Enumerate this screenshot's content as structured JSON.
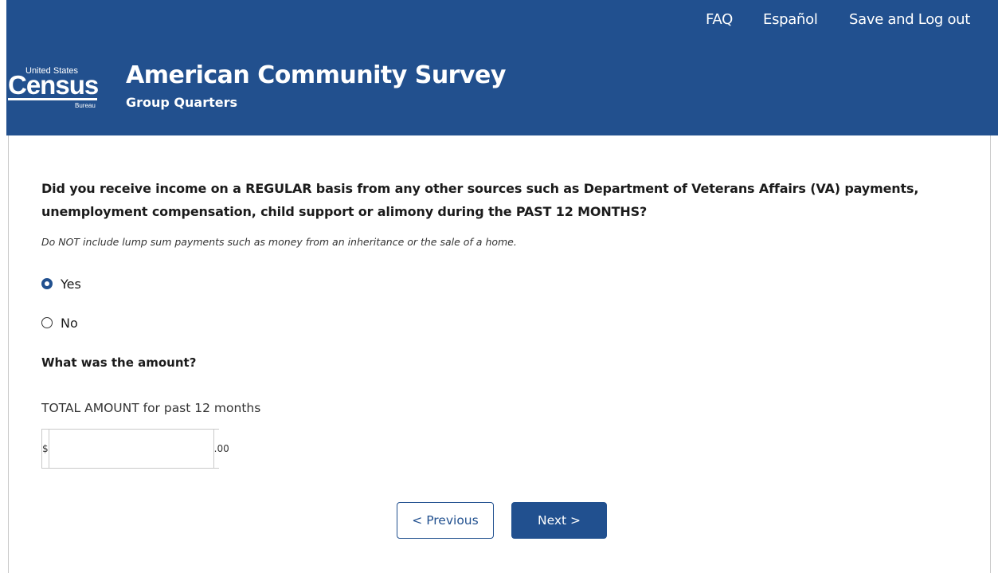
{
  "topnav": {
    "faq": "FAQ",
    "espanol": "Español",
    "save_logout": "Save and Log out"
  },
  "header": {
    "logo": {
      "united_states": "United States",
      "census": "Census",
      "bureau": "Bureau"
    },
    "title": "American Community Survey",
    "subtitle": "Group Quarters"
  },
  "question": {
    "text": "Did you receive income on a REGULAR basis from any other sources such as Department of Veterans Affairs (VA) payments, unemployment compensation, child support or alimony during the PAST 12 MONTHS?",
    "instruction": "Do NOT include lump sum payments such as money from an inheritance or the sale of a home.",
    "options": [
      {
        "label": "Yes",
        "selected": true
      },
      {
        "label": "No",
        "selected": false
      }
    ]
  },
  "amount": {
    "question": "What was the amount?",
    "label": "TOTAL AMOUNT for past 12 months",
    "prefix": "$",
    "suffix": ".00",
    "value": ""
  },
  "buttons": {
    "previous": "< Previous",
    "next": "Next >"
  },
  "colors": {
    "primary": "#21508f",
    "border": "#c9c9c9"
  }
}
